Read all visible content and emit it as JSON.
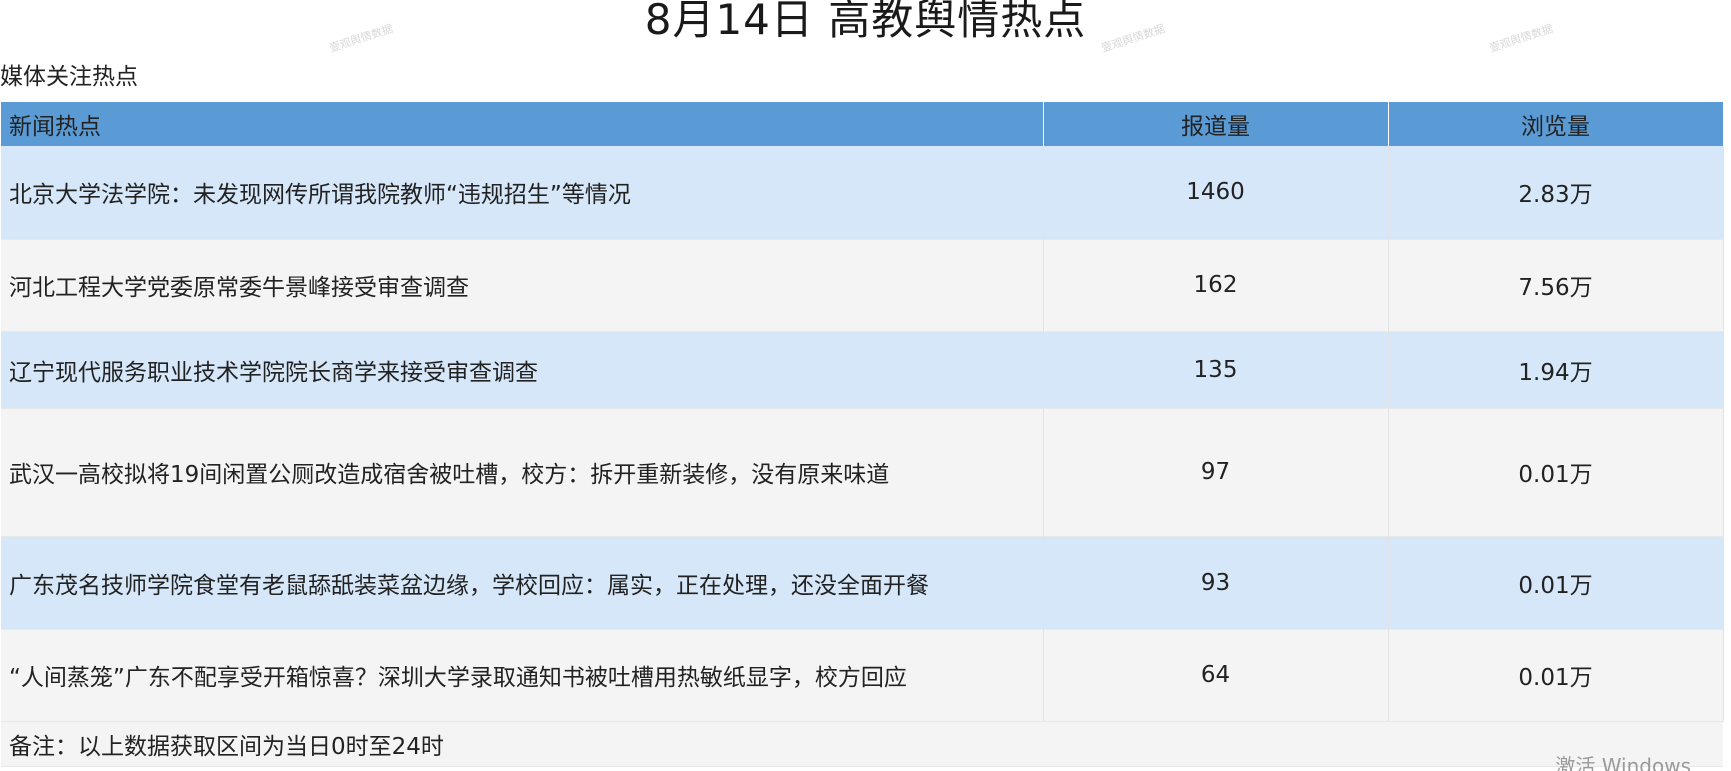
{
  "title": "8月14日 高教舆情热点",
  "watermark_text": "壹观舆情数据",
  "subtitle": "媒体关注热点",
  "table": {
    "headers": [
      "新闻热点",
      "报道量",
      "浏览量"
    ],
    "rows": [
      {
        "title": "北京大学法学院：未发现网传所谓我院教师“违规招生”等情况",
        "reports": "1460",
        "views": "2.83万"
      },
      {
        "title": "河北工程大学党委原常委牛景峰接受审查调查",
        "reports": "162",
        "views": "7.56万"
      },
      {
        "title": "辽宁现代服务职业技术学院院长商学来接受审查调查",
        "reports": "135",
        "views": "1.94万"
      },
      {
        "title": "武汉一高校拟将19间闲置公厕改造成宿舍被吐槽，校方：拆开重新装修，没有原来味道",
        "reports": "97",
        "views": "0.01万"
      },
      {
        "title": "广东茂名技师学院食堂有老鼠舔舐装菜盆边缘，学校回应：属实，正在处理，还没全面开餐",
        "reports": "93",
        "views": "0.01万"
      },
      {
        "title": "“人间蒸笼”广东不配享受开箱惊喜？深圳大学录取通知书被吐槽用热敏纸显字，校方回应",
        "reports": "64",
        "views": "0.01万"
      }
    ],
    "note": "备注：以上数据获取区间为当日0时至24时"
  },
  "system_overlay": "激活 Windows"
}
